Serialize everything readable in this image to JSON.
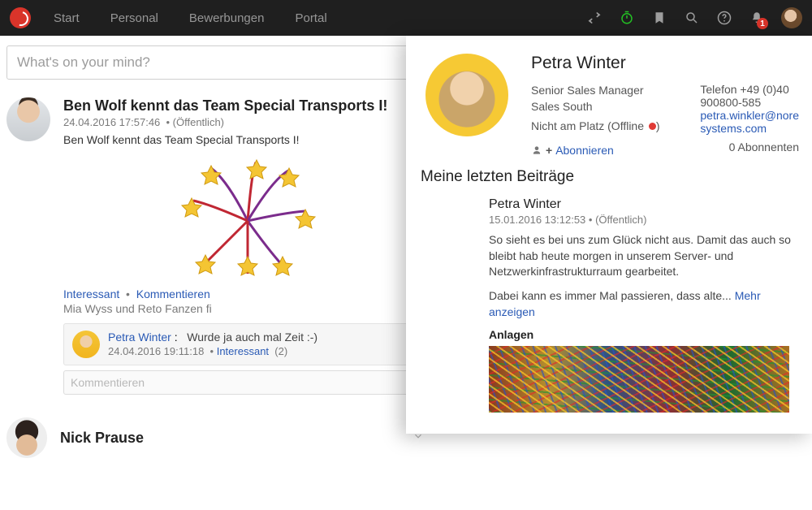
{
  "nav": {
    "items": [
      "Start",
      "Personal",
      "Bewerbungen",
      "Portal"
    ],
    "notification_count": "1"
  },
  "composer": {
    "placeholder": "What's on your mind?"
  },
  "post1": {
    "author": "Ben Wolf",
    "title": "Ben Wolf kennt das Team Special Transports I!",
    "meta_time": "24.04.2016 17:57:46",
    "meta_vis": "(Öffentlich)",
    "text": "Ben Wolf kennt das Team Special Transports I!",
    "action_interesting": "Interessant",
    "action_comment": "Kommentieren",
    "likes_text": "Mia Wyss und Reto Fanzen fi",
    "comment": {
      "author": "Petra Winter",
      "sep": ":",
      "text": "Wurde ja auch mal Zeit :-)",
      "meta_time": "24.04.2016 19:11:18",
      "meta_interesting": "Interessant",
      "meta_count": "(2)"
    },
    "comment_input_placeholder": "Kommentieren"
  },
  "post2": {
    "author": "Nick Prause"
  },
  "popover": {
    "name": "Petra Winter",
    "jobtitle": "Senior Sales Manager",
    "dept": "Sales South",
    "status_label": "Nicht am Platz (Offline",
    "status_close": ")",
    "phone1": "Telefon +49 (0)40",
    "phone2": "900800-585",
    "email1": "petra.winkler@nore",
    "email2": "systems.com",
    "follow_plus": "+",
    "follow_label": "Abonnieren",
    "subs": "0 Abonnenten",
    "section": "Meine letzten Beiträge",
    "post": {
      "author": "Petra Winter",
      "meta_time": "15.01.2016 13:12:53",
      "meta_vis": "(Öffentlich)",
      "text1": "So sieht es bei uns zum Glück nicht aus. Damit das auch so bleibt hab heute morgen in unserem Server- und Netzwerkinfrastrukturraum gearbeitet.",
      "text2a": "Dabei kann es immer Mal passieren, dass alte... ",
      "more": "Mehr anzeigen",
      "attach_label": "Anlagen"
    }
  }
}
